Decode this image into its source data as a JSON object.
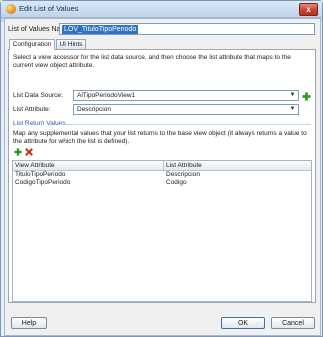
{
  "window": {
    "title": "Edit List of Values",
    "close_label": "x"
  },
  "lov": {
    "label": "List of Values Name:",
    "value": "LOV_TituloTipoPeriodo"
  },
  "tabs": [
    {
      "label": "Configuration"
    },
    {
      "label": "UI Hints"
    }
  ],
  "config": {
    "description": "Select a view accessor for the list data source, and then choose the list attribute that maps to the current view object attribute.",
    "data_source_label": "List Data Source:",
    "data_source_value": "AlTipoPeriodoView1",
    "list_attribute_label": "List Attribute:",
    "list_attribute_value": "Descripcion"
  },
  "return_values": {
    "section_title": "List Return Values",
    "description": "Map any supplemental values that your list returns to the base view object (it always returns a value to the attribute for which the list is defined).",
    "headers": [
      "View Attribute",
      "List Attribute"
    ],
    "rows": [
      [
        "TituloTipoPeriodo",
        "Descripcion"
      ],
      [
        "CodigoTipoPeriodo",
        "Codigo"
      ]
    ]
  },
  "footer": {
    "help_label": "Help",
    "ok_label": "OK",
    "cancel_label": "Cancel"
  },
  "colors": {
    "accent_blue": "#3072c4",
    "add_green": "#2e9b2a",
    "delete_red": "#c6281c"
  }
}
